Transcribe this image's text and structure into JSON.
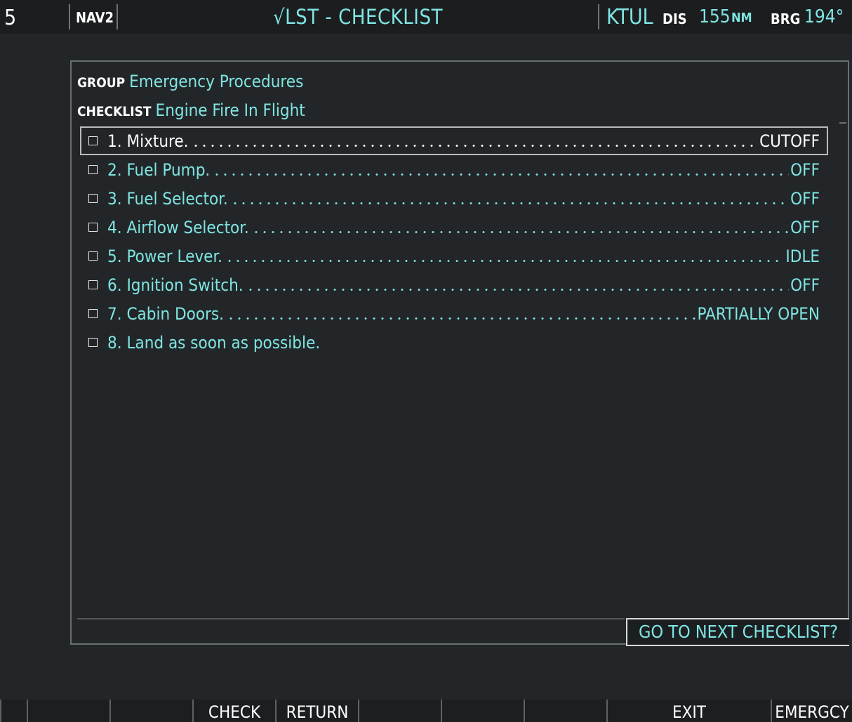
{
  "top_bar": {
    "page_number_fragment": "5",
    "nav_source": "NAV2",
    "page_title": "√LST - CHECKLIST",
    "destination": "KTUL",
    "dis_label": "DIS",
    "dis_value": "155",
    "dis_unit": "NM",
    "brg_label": "BRG",
    "brg_value": "194°"
  },
  "checklist": {
    "group_label": "GROUP",
    "group_value": "Emergency Procedures",
    "checklist_label": "CHECKLIST",
    "checklist_value": "Engine Fire In Flight",
    "items": [
      {
        "text": "1. Mixture.",
        "value": "CUTOFF",
        "checked": false,
        "selected": true
      },
      {
        "text": "2. Fuel Pump.",
        "value": "OFF",
        "checked": false,
        "selected": false
      },
      {
        "text": "3. Fuel Selector.",
        "value": "OFF",
        "checked": false,
        "selected": false
      },
      {
        "text": "4. Airflow Selector.",
        "value": "OFF",
        "checked": false,
        "selected": false
      },
      {
        "text": "5. Power Lever.",
        "value": "IDLE",
        "checked": false,
        "selected": false
      },
      {
        "text": "6. Ignition Switch.",
        "value": "OFF",
        "checked": false,
        "selected": false
      },
      {
        "text": "7. Cabin Doors.",
        "value": "PARTIALLY OPEN",
        "checked": false,
        "selected": false
      },
      {
        "text": "8. Land as soon as possible.",
        "value": "",
        "checked": false,
        "selected": false
      }
    ],
    "next_prompt": "GO TO NEXT CHECKLIST?"
  },
  "softkeys": [
    "",
    "",
    "",
    "CHECK",
    "RETURN",
    "",
    "",
    "",
    "EXIT",
    "EMERGCY"
  ],
  "colors": {
    "background": "#232628",
    "cyan_text": "#7fe5e3",
    "white_text": "#ffffff",
    "border_gray": "#6a6f72"
  }
}
